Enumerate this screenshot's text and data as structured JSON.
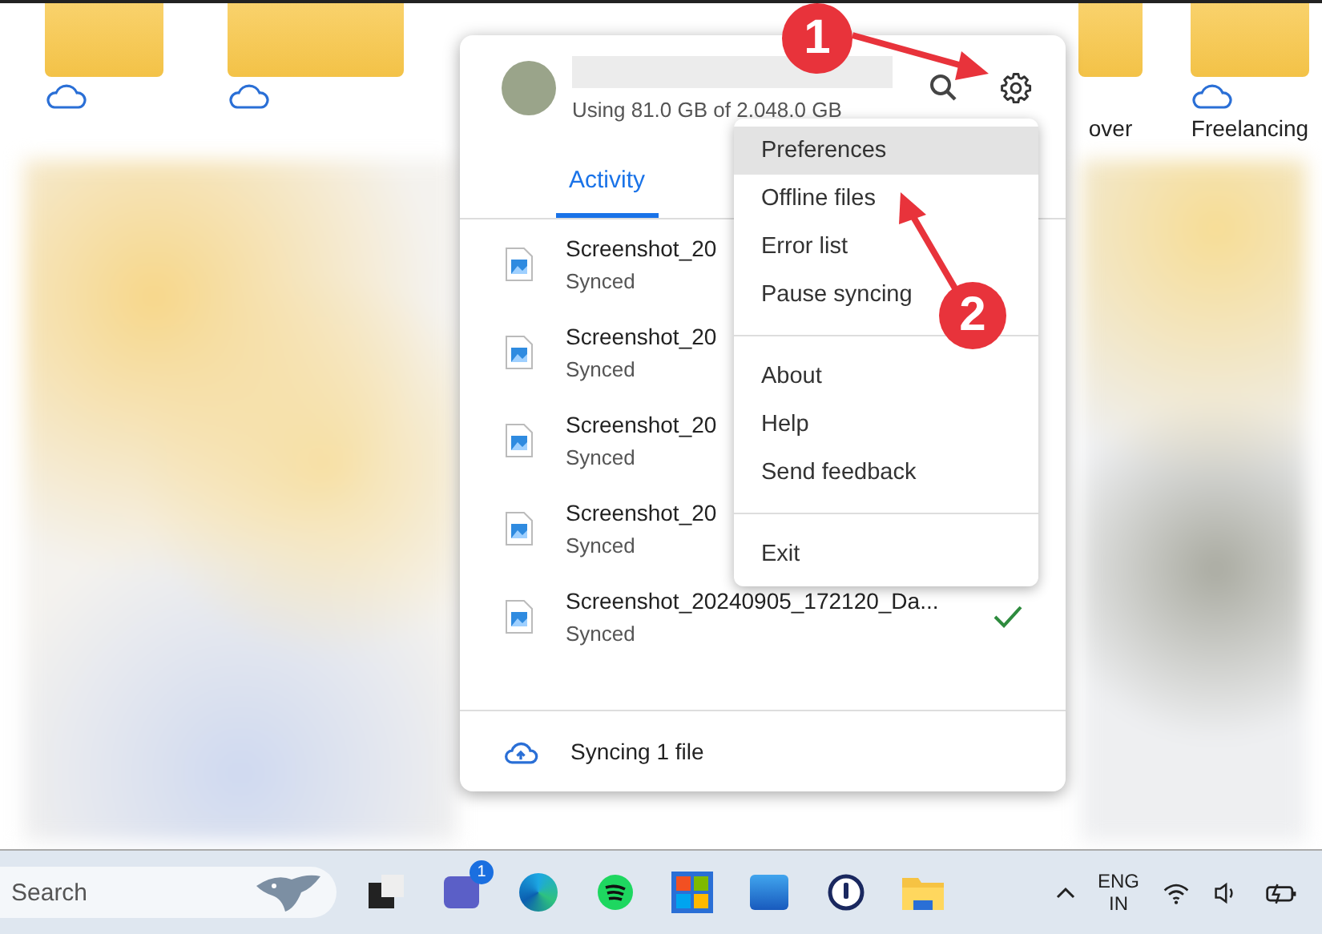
{
  "explorer": {
    "labels": [
      {
        "text": "over"
      },
      {
        "text": "Freelancing"
      }
    ]
  },
  "drive_panel": {
    "storage": "Using 81.0 GB of 2.048.0 GB",
    "tabs": [
      {
        "label": "Activity",
        "selected": true
      }
    ],
    "files": [
      {
        "name": "Screenshot_20",
        "status": "Synced"
      },
      {
        "name": "Screenshot_20",
        "status": "Synced"
      },
      {
        "name": "Screenshot_20",
        "status": "Synced"
      },
      {
        "name": "Screenshot_20",
        "status": "Synced"
      },
      {
        "name": "Screenshot_20240905_172120_Da...",
        "status": "Synced",
        "synced": true
      }
    ],
    "footer": "Syncing 1 file"
  },
  "settings_menu": {
    "groups": [
      [
        {
          "label": "Preferences",
          "selected": true
        },
        {
          "label": "Offline files",
          "selected": false
        },
        {
          "label": "Error list",
          "selected": false
        },
        {
          "label": "Pause syncing",
          "selected": false
        }
      ],
      [
        {
          "label": "About",
          "selected": false
        },
        {
          "label": "Help",
          "selected": false
        },
        {
          "label": "Send feedback",
          "selected": false
        }
      ],
      [
        {
          "label": "Exit",
          "selected": false
        }
      ]
    ]
  },
  "annotations": [
    {
      "number": "1"
    },
    {
      "number": "2"
    }
  ],
  "taskbar": {
    "search": {
      "placeholder": "Search"
    },
    "teams_badge": "1",
    "language": [
      "ENG",
      "IN"
    ]
  }
}
